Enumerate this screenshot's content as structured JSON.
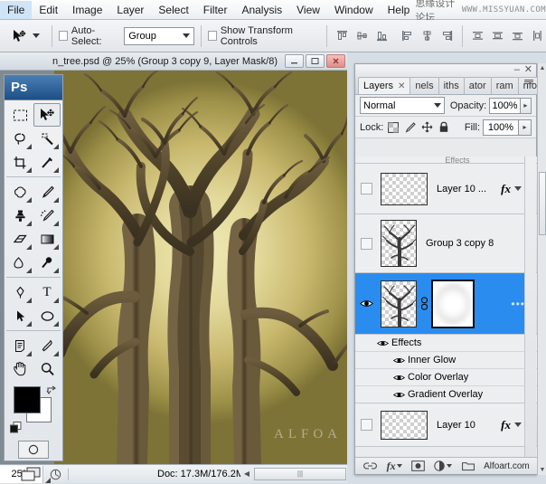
{
  "app": {
    "name": "Adobe Photoshop",
    "logo_text": "Ps"
  },
  "menubar": {
    "items": [
      "File",
      "Edit",
      "Image",
      "Layer",
      "Select",
      "Filter",
      "Analysis",
      "View",
      "Window",
      "Help"
    ],
    "watermark_cn": "思缘设计论坛",
    "watermark_url": "WWW.MISSYUAN.COM"
  },
  "options_bar": {
    "tool_icon": "move-tool-icon",
    "auto_select_label": "Auto-Select:",
    "auto_select_checked": false,
    "auto_select_value": "Group",
    "show_transform_label": "Show Transform Controls",
    "show_transform_checked": false,
    "align_icons": [
      "align-top-edges-icon",
      "align-vertical-centers-icon",
      "align-bottom-edges-icon",
      "align-left-edges-icon",
      "align-horizontal-centers-icon",
      "align-right-edges-icon"
    ],
    "distribute_icons": [
      "distribute-top-edges-icon",
      "distribute-vertical-centers-icon",
      "distribute-bottom-edges-icon",
      "distribute-left-edges-icon"
    ]
  },
  "document": {
    "title": "n_tree.psd @ 25% (Group 3 copy 9, Layer Mask/8)",
    "canvas_watermark": "ALFOA",
    "window_buttons": [
      "minimize",
      "maximize",
      "close"
    ]
  },
  "status_bar": {
    "zoom": "25%",
    "doc_info": "Doc: 17.3M/176.2M",
    "play_arrow": "▶"
  },
  "toolbox": {
    "tools": [
      {
        "name": "rectangular-marquee-tool",
        "glyph": "marquee",
        "has_flyout": false,
        "active": false
      },
      {
        "name": "move-tool",
        "glyph": "move",
        "has_flyout": false,
        "active": true
      },
      {
        "name": "lasso-tool",
        "glyph": "lasso",
        "has_flyout": true,
        "active": false
      },
      {
        "name": "magic-wand-tool",
        "glyph": "wand",
        "has_flyout": true,
        "active": false
      },
      {
        "name": "crop-tool",
        "glyph": "crop",
        "has_flyout": true,
        "active": false
      },
      {
        "name": "slice-tool",
        "glyph": "slice",
        "has_flyout": true,
        "active": false
      },
      {
        "name": "healing-brush-tool",
        "glyph": "heal",
        "has_flyout": true,
        "active": false
      },
      {
        "name": "brush-tool",
        "glyph": "brush",
        "has_flyout": true,
        "active": false
      },
      {
        "name": "clone-stamp-tool",
        "glyph": "stamp",
        "has_flyout": true,
        "active": false
      },
      {
        "name": "history-brush-tool",
        "glyph": "historybrush",
        "has_flyout": true,
        "active": false
      },
      {
        "name": "eraser-tool",
        "glyph": "eraser",
        "has_flyout": true,
        "active": false
      },
      {
        "name": "gradient-tool",
        "glyph": "gradient",
        "has_flyout": true,
        "active": false
      },
      {
        "name": "blur-tool",
        "glyph": "blur",
        "has_flyout": true,
        "active": false
      },
      {
        "name": "dodge-tool",
        "glyph": "dodge",
        "has_flyout": true,
        "active": false
      },
      {
        "name": "pen-tool",
        "glyph": "pen",
        "has_flyout": true,
        "active": false
      },
      {
        "name": "horizontal-type-tool",
        "glyph": "type",
        "has_flyout": true,
        "active": false
      },
      {
        "name": "path-selection-tool",
        "glyph": "pathselect",
        "has_flyout": true,
        "active": false
      },
      {
        "name": "ellipse-tool",
        "glyph": "ellipse",
        "has_flyout": true,
        "active": false
      },
      {
        "name": "notes-tool",
        "glyph": "notes",
        "has_flyout": true,
        "active": false
      },
      {
        "name": "eyedropper-tool",
        "glyph": "eyedropper",
        "has_flyout": true,
        "active": false
      },
      {
        "name": "hand-tool",
        "glyph": "hand",
        "has_flyout": false,
        "active": false
      },
      {
        "name": "zoom-tool",
        "glyph": "zoom",
        "has_flyout": false,
        "active": false
      }
    ],
    "foreground_color": "#000000",
    "background_color": "#ffffff",
    "quick_mask_label": "quick-mask-mode",
    "screen_mode_label": "screen-mode"
  },
  "layers_panel": {
    "tabs": [
      {
        "label": "Layers",
        "active": true,
        "closable": true
      },
      {
        "label": "nels",
        "active": false,
        "closable": false
      },
      {
        "label": "iths",
        "active": false,
        "closable": false
      },
      {
        "label": "ator",
        "active": false,
        "closable": false
      },
      {
        "label": "ram",
        "active": false,
        "closable": false
      },
      {
        "label": "nfo",
        "active": false,
        "closable": false
      }
    ],
    "blend_mode": "Normal",
    "opacity_label": "Opacity:",
    "opacity_value": "100%",
    "lock_label": "Lock:",
    "lock_icons": [
      "lock-transparent-pixels-icon",
      "lock-image-pixels-icon",
      "lock-position-icon",
      "lock-all-icon"
    ],
    "fill_label": "Fill:",
    "fill_value": "100%",
    "layers": [
      {
        "name": "Layer 10 ...",
        "has_fx": true,
        "visible": false,
        "selected": false,
        "type": "layer"
      },
      {
        "name": "Group 3 copy 8",
        "has_fx": false,
        "visible": false,
        "selected": false,
        "type": "group"
      },
      {
        "name": "",
        "has_fx": false,
        "visible": true,
        "selected": true,
        "type": "masked-layer",
        "dots": "•••"
      }
    ],
    "effects": [
      {
        "label": "Effects",
        "level": 1
      },
      {
        "label": "Inner Glow",
        "level": 2
      },
      {
        "label": "Color Overlay",
        "level": 2
      },
      {
        "label": "Gradient Overlay",
        "level": 2
      }
    ],
    "bottom_layer": {
      "name": "Layer 10",
      "has_fx": true,
      "visible": false
    },
    "bottom_bar_icons": [
      "link-layers-icon",
      "add-layer-style-icon",
      "add-layer-mask-icon",
      "new-adjustment-layer-icon",
      "new-group-icon"
    ],
    "bottom_bar_watermark": "Alfoart.com"
  },
  "colors": {
    "accent_selection": "#2b8cf0",
    "panel_bg": "#e8eaec",
    "chrome_bg": "#d6dde4",
    "canvas_highlight": "#efe9b4",
    "canvas_shadow": "#7d7336",
    "tree_brown": "#5b4a2e"
  }
}
